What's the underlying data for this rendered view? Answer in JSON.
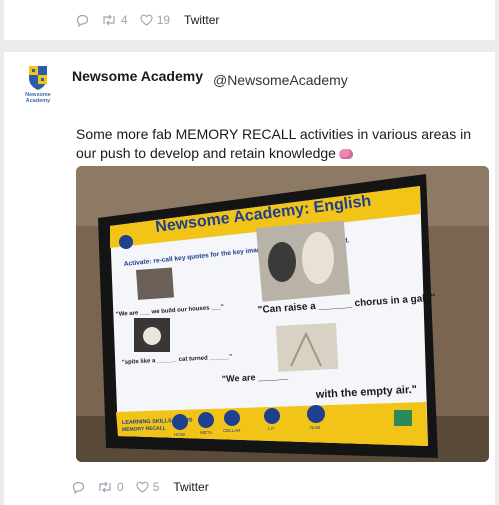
{
  "top_tweet": {
    "retweets": "4",
    "likes": "19",
    "source": "Twitter"
  },
  "tweet": {
    "display_name": "Newsome Academy",
    "handle": "@NewsomeAcademy",
    "avatar_text": "Newsome Academy",
    "text": "Some more fab MEMORY RECALL activities in various areas in our push to develop and retain knowledge",
    "retweets": "0",
    "likes": "5",
    "source": "Twitter"
  },
  "slide": {
    "title": "Newsome Academy: English",
    "instruction": "Activate: re-call key quotes for the key images from Storm on the Island.",
    "quote1": "\"We are ___ we build our houses ___\"",
    "quote2": "\"Can raise a ______ chorus in a gale\"",
    "quote3": "\"spits like a ______ cat turned ______\"",
    "quote4a": "\"We are ______",
    "quote4b": "with the empty air.\"",
    "skills_label": "LEARNING SKILLS FOCUS",
    "skills_sub": "MEMORY RECALL",
    "circles": [
      "HOW",
      "META",
      "CELLAR",
      "LIT",
      "NUM"
    ]
  },
  "colors": {
    "accent": "#1d9bf0",
    "slide_yellow": "#f2c417",
    "slide_blue": "#1f3f8f",
    "text_gray": "#9aa5b1"
  }
}
